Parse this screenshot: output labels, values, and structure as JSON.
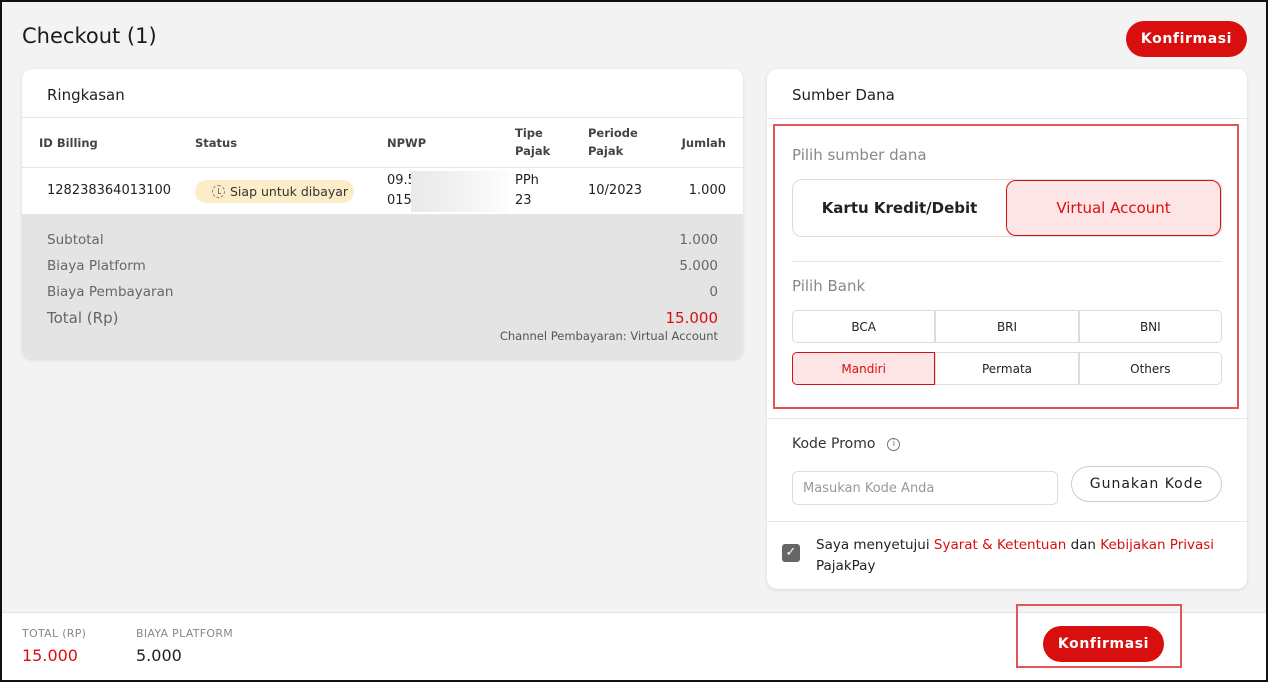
{
  "header": {
    "title": "Checkout (1)",
    "confirm_label": "Konfirmasi"
  },
  "summary": {
    "title": "Ringkasan",
    "columns": {
      "id_billing": "ID Billing",
      "status": "Status",
      "npwp": "NPWP",
      "tipe_pajak_1": "Tipe",
      "tipe_pajak_2": "Pajak",
      "periode_pajak_1": "Periode",
      "periode_pajak_2": "Pajak",
      "jumlah": "Jumlah"
    },
    "row": {
      "id_billing": "128238364013100",
      "status": "Siap untuk dibayar",
      "npwp_1": "09.5",
      "npwp_2": "015",
      "tipe_pajak_1": "PPh",
      "tipe_pajak_2": "23",
      "periode_pajak": "10/2023",
      "jumlah": "1.000"
    },
    "totals": {
      "subtotal_label": "Subtotal",
      "subtotal_value": "1.000",
      "platform_label": "Biaya Platform",
      "platform_value": "5.000",
      "payment_label": "Biaya Pembayaran",
      "payment_value": "0",
      "total_label": "Total (Rp)",
      "total_value": "15.000",
      "channel": "Channel Pembayaran: Virtual Account"
    }
  },
  "funds": {
    "title": "Sumber Dana",
    "choose_source_label": "Pilih sumber dana",
    "sources": [
      "Kartu Kredit/Debit",
      "Virtual Account"
    ],
    "choose_bank_label": "Pilih Bank",
    "banks": [
      "BCA",
      "BRI",
      "BNI",
      "Mandiri",
      "Permata",
      "Others"
    ],
    "selected_bank": "Mandiri",
    "promo_label": "Kode Promo",
    "promo_placeholder": "Masukan Kode Anda",
    "promo_button": "Gunakan Kode",
    "agree_1": "Saya menyetujui ",
    "agree_link_1": "Syarat & Ketentuan",
    "agree_2": " dan ",
    "agree_link_2": "Kebijakan Privasi",
    "agree_3": " PajakPay"
  },
  "footer": {
    "total_label": "TOTAL (RP)",
    "total_value": "15.000",
    "platform_label": "BIAYA PLATFORM",
    "platform_value": "5.000",
    "confirm_label": "Konfirmasi"
  },
  "colors": {
    "accent": "#d90f0f",
    "selected_bg": "#fde5e5",
    "highlight": "#e05555"
  }
}
